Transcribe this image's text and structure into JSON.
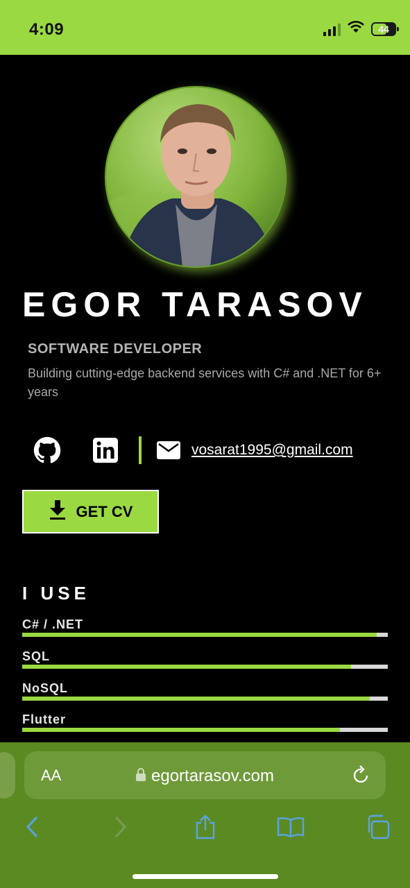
{
  "status_bar": {
    "time": "4:09",
    "battery": "44",
    "icons": [
      "signal-icon",
      "wifi-icon",
      "battery-icon"
    ]
  },
  "profile": {
    "name": "EGOR TARASOV",
    "role": "SOFTWARE DEVELOPER",
    "tagline": "Building cutting-edge backend services with C# and .NET for 6+ years"
  },
  "contacts": {
    "icons": [
      "github-icon",
      "linkedin-icon",
      "mail-icon"
    ],
    "email": "vosarat1995@gmail.com"
  },
  "cv_button": {
    "label": "GET CV",
    "icon": "download-icon"
  },
  "skills": {
    "title": "I USE",
    "items": [
      {
        "label": "C# / .NET",
        "level": 0.97
      },
      {
        "label": "SQL",
        "level": 0.9
      },
      {
        "label": "NoSQL",
        "level": 0.95
      },
      {
        "label": "Flutter",
        "level": 0.87
      }
    ]
  },
  "browser": {
    "text_size_label": "AA",
    "url": "egortarasov.com",
    "toolbar_icons": [
      "back-icon",
      "forward-icon",
      "share-icon",
      "bookmarks-icon",
      "tabs-icon"
    ]
  },
  "colors": {
    "accent": "#9ad941",
    "background": "#000000",
    "browser_chrome": "#5c8a22"
  }
}
